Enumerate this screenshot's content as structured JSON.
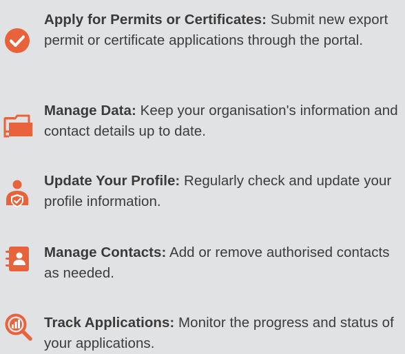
{
  "accent_color": "#e8623c",
  "items": [
    {
      "icon": "check-circle-icon",
      "title": "Apply for Permits or Certificates:",
      "description": " Submit new export permit or certificate applications through the portal."
    },
    {
      "icon": "folders-icon",
      "title": "Manage Data:",
      "description": " Keep your organisation's information and contact details up to date."
    },
    {
      "icon": "user-shield-icon",
      "title": "Update Your Profile:",
      "description": " Regularly check and update your profile information."
    },
    {
      "icon": "address-book-icon",
      "title": "Manage Contacts:",
      "description": " Add or remove authorised contacts as needed."
    },
    {
      "icon": "magnifier-chart-icon",
      "title": "Track Applications:",
      "description": " Monitor the progress and status of your applications."
    }
  ]
}
